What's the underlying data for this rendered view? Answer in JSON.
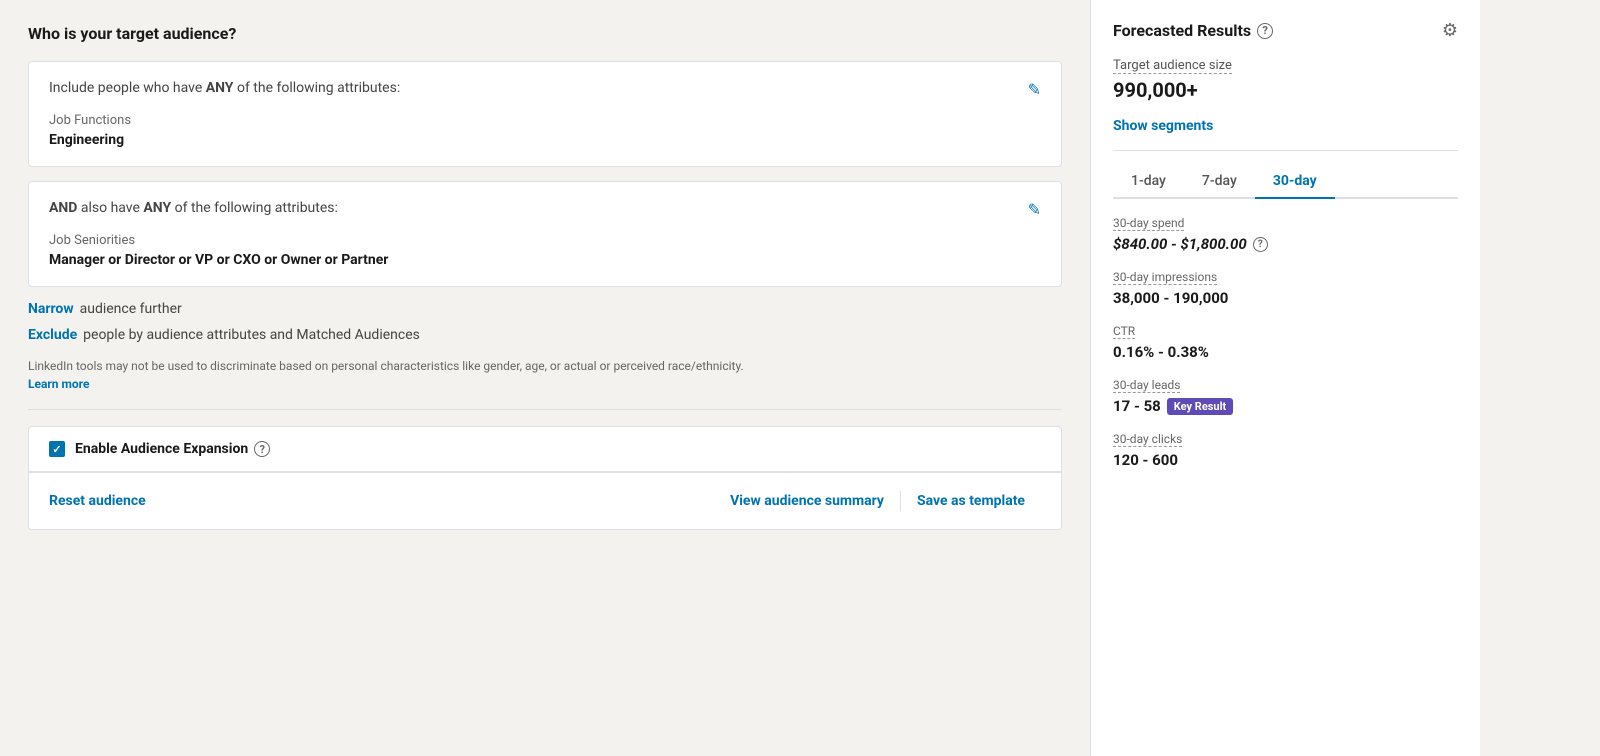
{
  "page": {
    "title": "Who is your target audience?"
  },
  "card1": {
    "header": "Include people who have ",
    "header_bold": "ANY",
    "header_rest": " of the following attributes:",
    "field_label": "Job Functions",
    "field_value": "Engineering"
  },
  "card2": {
    "header_prefix": "AND",
    "header_middle": " also have ",
    "header_bold": "ANY",
    "header_rest": " of the following attributes:",
    "field_label": "Job Seniorities",
    "values": [
      "Manager",
      "Director",
      "VP",
      "CXO",
      "Owner",
      "Partner"
    ]
  },
  "narrow": {
    "link": "Narrow",
    "text": "audience further"
  },
  "exclude": {
    "link": "Exclude",
    "text": "people by audience attributes and Matched Audiences"
  },
  "disclaimer": {
    "text": "LinkedIn tools may not be used to discriminate based on personal characteristics like gender, age, or actual or perceived race/ethnicity.",
    "link": "Learn more"
  },
  "expansion": {
    "label": "Enable Audience Expansion"
  },
  "footer": {
    "reset": "Reset audience",
    "view_summary": "View audience summary",
    "save_template": "Save as template"
  },
  "right_panel": {
    "title": "Forecasted Results",
    "audience_size_label": "Target audience size",
    "audience_size_value": "990,000+",
    "show_segments": "Show segments",
    "tabs": [
      "1-day",
      "7-day",
      "30-day"
    ],
    "active_tab": "30-day",
    "spend_label": "30-day spend",
    "spend_value": "$840.00 - $1,800.00",
    "impressions_label": "30-day impressions",
    "impressions_value": "38,000 - 190,000",
    "ctr_label": "CTR",
    "ctr_value": "0.16% - 0.38%",
    "leads_label": "30-day leads",
    "leads_value": "17 - 58",
    "leads_badge": "Key Result",
    "clicks_label": "30-day clicks",
    "clicks_value": "120 - 600"
  }
}
